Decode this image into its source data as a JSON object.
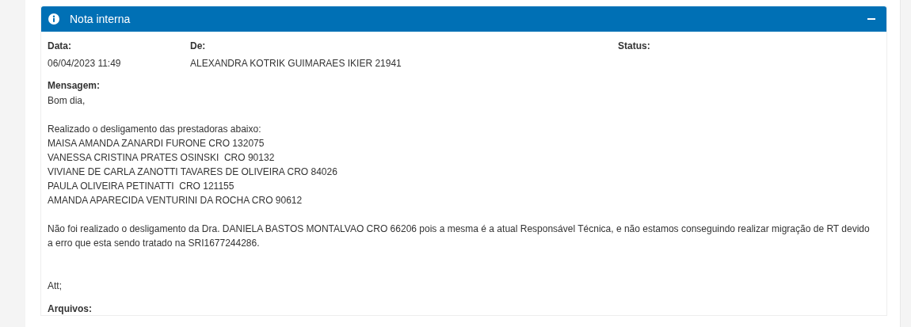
{
  "panel": {
    "title": "Nota interna",
    "expanded": true
  },
  "fields": [
    {
      "label": "Data:",
      "value": "06/04/2023 11:49"
    },
    {
      "label": "De:",
      "value": "ALEXANDRA KOTRIK GUIMARAES IKIER 21941"
    },
    {
      "label": "Status:"
    }
  ],
  "message": {
    "label": "Mensagem:",
    "text": "Bom dia,\n\nRealizado o desligamento das prestadoras abaixo:\nMAISA AMANDA ZANARDI FURONE CRO 132075\nVANESSA CRISTINA PRATES OSINSKI  CRO 90132\nVIVIANE DE CARLA ZANOTTI TAVARES DE OLIVEIRA CRO 84026\nPAULA OLIVEIRA PETINATTI  CRO 121155\nAMANDA APARECIDA VENTURINI DA ROCHA CRO 90612\n\nNão foi realizado o desligamento da Dra. DANIELA BASTOS MONTALVAO CRO 66206 pois a mesma é a atual Responsável Técnica, e não estamos conseguindo realizar migração de RT devido a erro que esta sendo tratado na SRI1677244286.\n\n\nAtt;"
  },
  "attachments": {
    "label": "Arquivos:"
  }
}
